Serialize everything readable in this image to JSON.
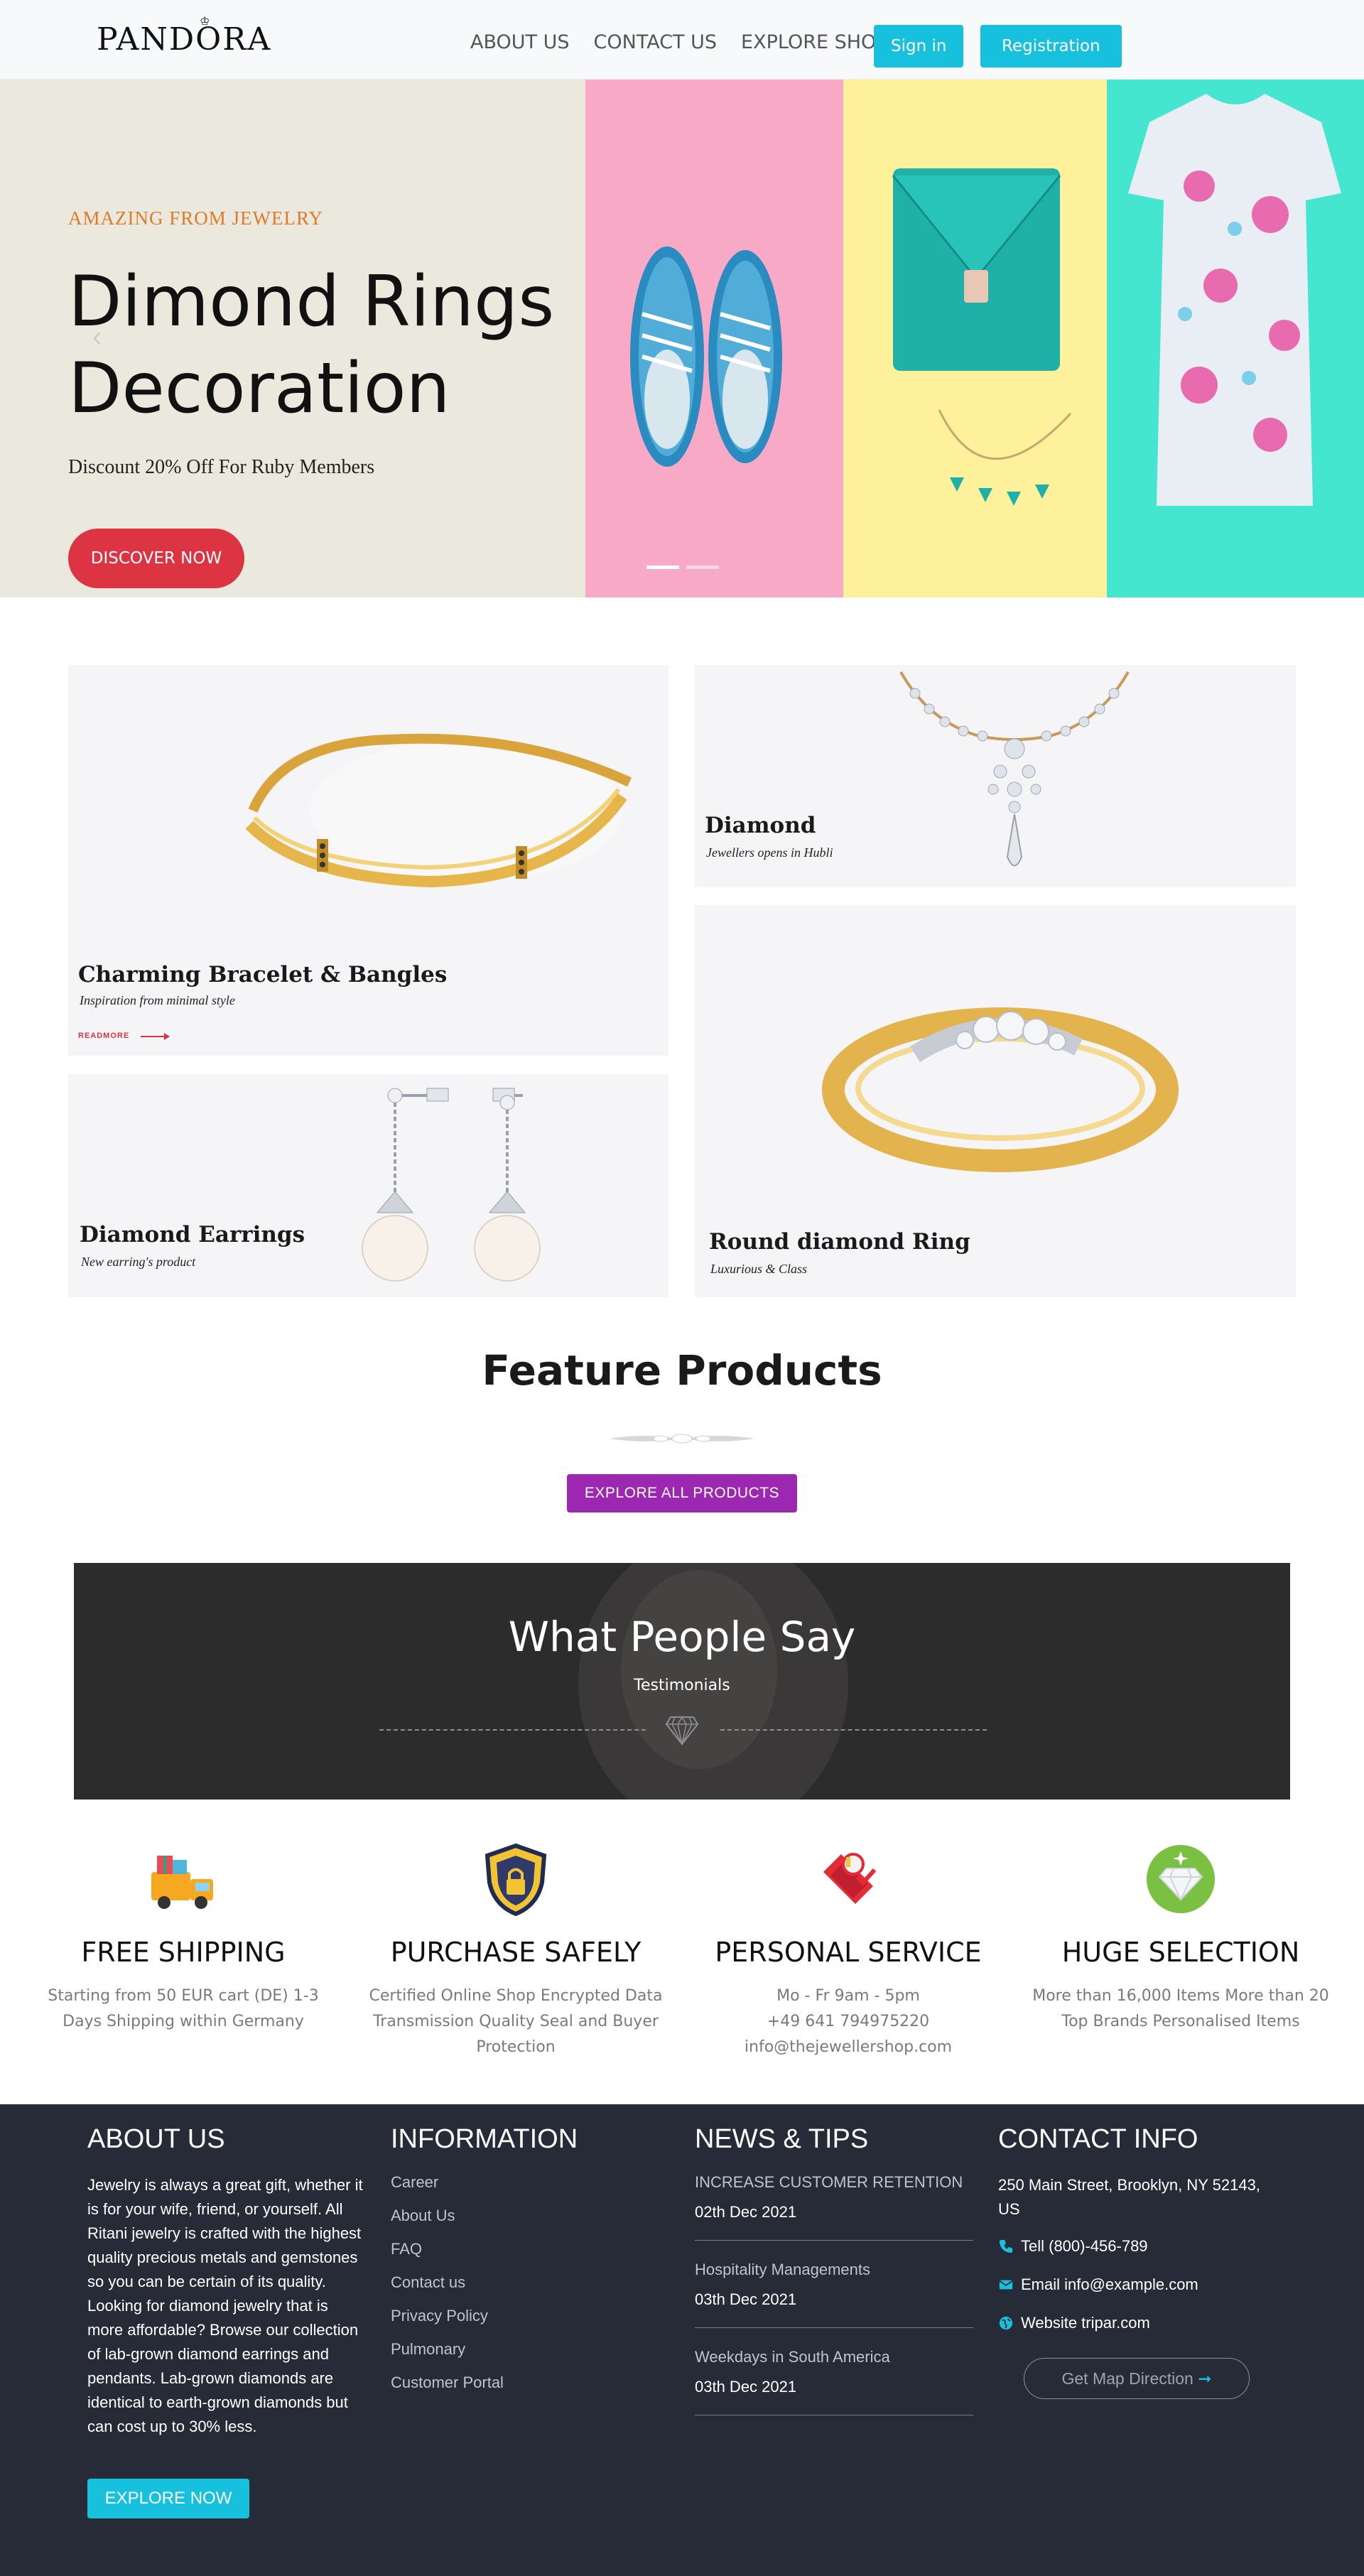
{
  "header": {
    "logo": "PANDORA",
    "nav": [
      {
        "label": "ABOUT US"
      },
      {
        "label": "CONTACT US"
      },
      {
        "label": "EXPLORE SHOP"
      }
    ],
    "signin_label": "Sign in",
    "register_label": "Registration"
  },
  "hero": {
    "kicker": "AMAZING FROM JEWELRY",
    "title_line1": "Dimond Rings",
    "title_line2": "Decoration",
    "subtitle": "Discount 20% Off For Ruby Members",
    "cta_label": "DISCOVER NOW",
    "slide_count": 2,
    "active_slide": 1,
    "colors": {
      "left": "#ebe9dd",
      "pink": "#f8a9c6",
      "yellow": "#fdf19c",
      "teal": "#45e6cf"
    }
  },
  "categories": {
    "bracelet": {
      "title": "Charming Bracelet & Bangles",
      "subtitle": "Inspiration from minimal style",
      "readmore": "READMORE"
    },
    "diamond": {
      "title": "Diamond",
      "subtitle": "Jewellers opens in Hubli"
    },
    "earrings": {
      "title": "Diamond Earrings",
      "subtitle": "New earring's product"
    },
    "ring": {
      "title": "Round diamond Ring",
      "subtitle": "Luxurious & Class"
    }
  },
  "feature": {
    "title": "Feature Products",
    "button_label": "EXPLORE ALL PRODUCTS"
  },
  "testimonials": {
    "title": "What People Say",
    "subtitle": "Testimonials"
  },
  "services": [
    {
      "icon": "delivery-truck-icon",
      "title": "FREE SHIPPING",
      "text": "Starting from 50 EUR cart (DE) 1-3 Days Shipping within Germany"
    },
    {
      "icon": "secure-shield-icon",
      "title": "PURCHASE SAFELY",
      "text": "Certified Online Shop Encrypted Data Transmission Quality Seal and Buyer Protection"
    },
    {
      "icon": "phone-service-icon",
      "title": "PERSONAL SERVICE",
      "lines": [
        "Mo - Fr 9am - 5pm",
        "+49 641 794975220",
        "info@thejewellershop.com"
      ]
    },
    {
      "icon": "diamond-selection-icon",
      "title": "HUGE SELECTION",
      "text": "More than 16,000 Items More than 20 Top Brands Personalised Items"
    }
  ],
  "footer": {
    "about": {
      "heading": "ABOUT US",
      "text": "Jewelry is always a great gift, whether it is for your wife, friend, or yourself. All Ritani jewelry is crafted with the highest quality precious metals and gemstones so you can be certain of its quality. Looking for diamond jewelry that is more affordable? Browse our collection of lab-grown diamond earrings and pendants. Lab-grown diamonds are identical to earth-grown diamonds but can cost up to 30% less.",
      "button_label": "EXPLORE NOW"
    },
    "information": {
      "heading": "INFORMATION",
      "links": [
        "Career",
        "About Us",
        "FAQ",
        "Contact us",
        "Privacy Policy",
        "Pulmonary",
        "Customer Portal"
      ]
    },
    "news": {
      "heading": "NEWS & TIPS",
      "items": [
        {
          "title": "INCREASE CUSTOMER RETENTION",
          "date": "02th Dec 2021"
        },
        {
          "title": "Hospitality Managements",
          "date": "03th Dec 2021"
        },
        {
          "title": "Weekdays in South America",
          "date": "03th Dec 2021"
        }
      ]
    },
    "contact": {
      "heading": "CONTACT INFO",
      "address": "250 Main Street, Brooklyn, NY 52143, US",
      "phone": "Tell (800)-456-789",
      "email": "Email info@example.com",
      "website": "Website tripar.com",
      "map_label": "Get Map Direction"
    }
  }
}
